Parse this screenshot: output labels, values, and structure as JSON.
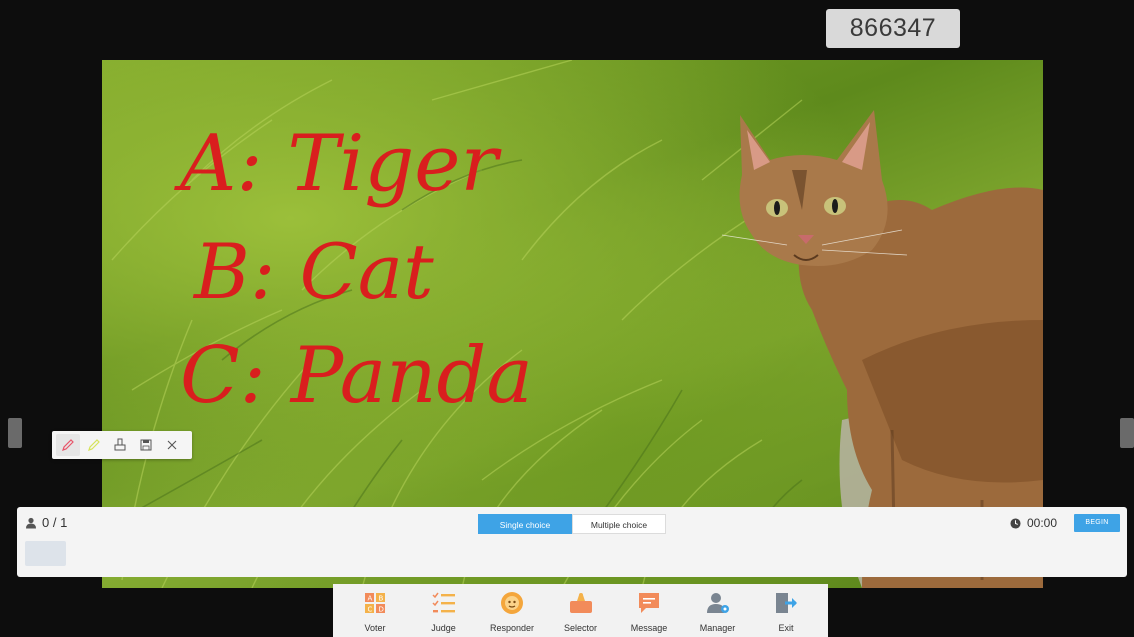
{
  "room_code": "866347",
  "board": {
    "handwriting": [
      "A: Tiger",
      "B: Cat",
      "C: Panda"
    ],
    "ink_color": "#d91e1e"
  },
  "pen_toolbar": {
    "tools": [
      "pen-icon",
      "highlighter-icon",
      "eraser-icon",
      "save-icon",
      "close-icon"
    ]
  },
  "vote_panel": {
    "count": "0 / 1",
    "modes": [
      "Single choice",
      "Multiple choice"
    ],
    "active_mode": "Single choice",
    "timer": "00:00",
    "begin_label": "BEGIN",
    "accent": "#3ea3e6"
  },
  "dock": {
    "items": [
      {
        "label": "Voter",
        "icon": "voter-icon"
      },
      {
        "label": "Judge",
        "icon": "judge-icon"
      },
      {
        "label": "Responder",
        "icon": "responder-icon"
      },
      {
        "label": "Selector",
        "icon": "selector-icon"
      },
      {
        "label": "Message",
        "icon": "message-icon"
      },
      {
        "label": "Manager",
        "icon": "manager-icon"
      },
      {
        "label": "Exit",
        "icon": "exit-icon"
      }
    ]
  }
}
